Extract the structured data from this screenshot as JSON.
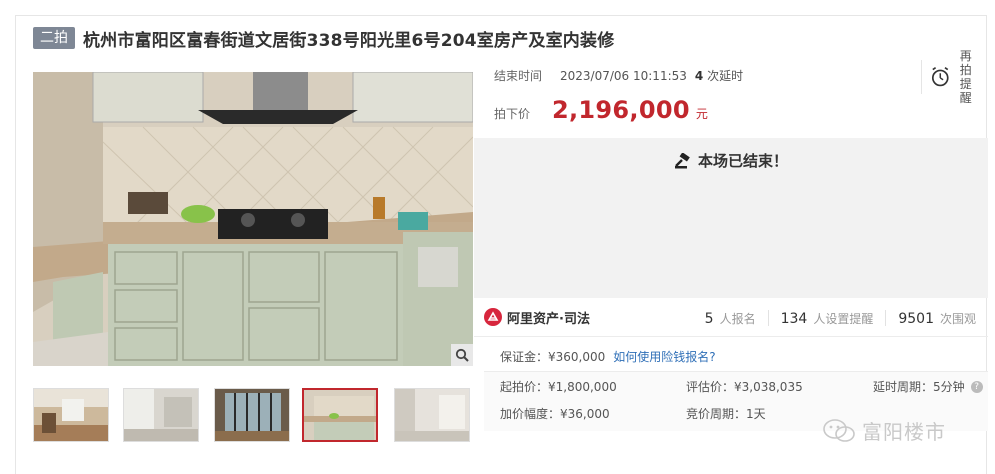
{
  "header": {
    "badge": "二拍",
    "title": "杭州市富阳区富春街道文居街338号阳光里6号204室房产及室内装修"
  },
  "auction": {
    "end_label": "结束时间",
    "end_time": "2023/07/06 10:11:53",
    "extension_count": "4",
    "extension_suffix": "次延时",
    "remind_label_1": "再拍",
    "remind_label_2": "提醒",
    "price_label": "拍下价",
    "price": "2,196,000",
    "price_unit": "元",
    "ended_message": "本场已结束！"
  },
  "platform": {
    "name": "阿里资产·司法"
  },
  "stats": [
    {
      "value": "5",
      "label": "人报名"
    },
    {
      "value": "134",
      "label": "人设置提醒"
    },
    {
      "value": "9501",
      "label": "次围观"
    }
  ],
  "deposit": {
    "text": "保证金：¥360,000",
    "link": "如何使用险钱报名?"
  },
  "details": {
    "start_price": "起拍价：¥1,800,000",
    "appraisal": "评估价：¥3,038,035",
    "delay_period": "延时周期：5分钟",
    "increment": "加价幅度：¥36,000",
    "bid_period": "竞价周期：1天"
  },
  "watermark": {
    "text": "富阳楼市"
  },
  "colors": {
    "price_red": "#c1272d",
    "badge_gray": "#7e8795",
    "link_blue": "#2f6fb7"
  }
}
